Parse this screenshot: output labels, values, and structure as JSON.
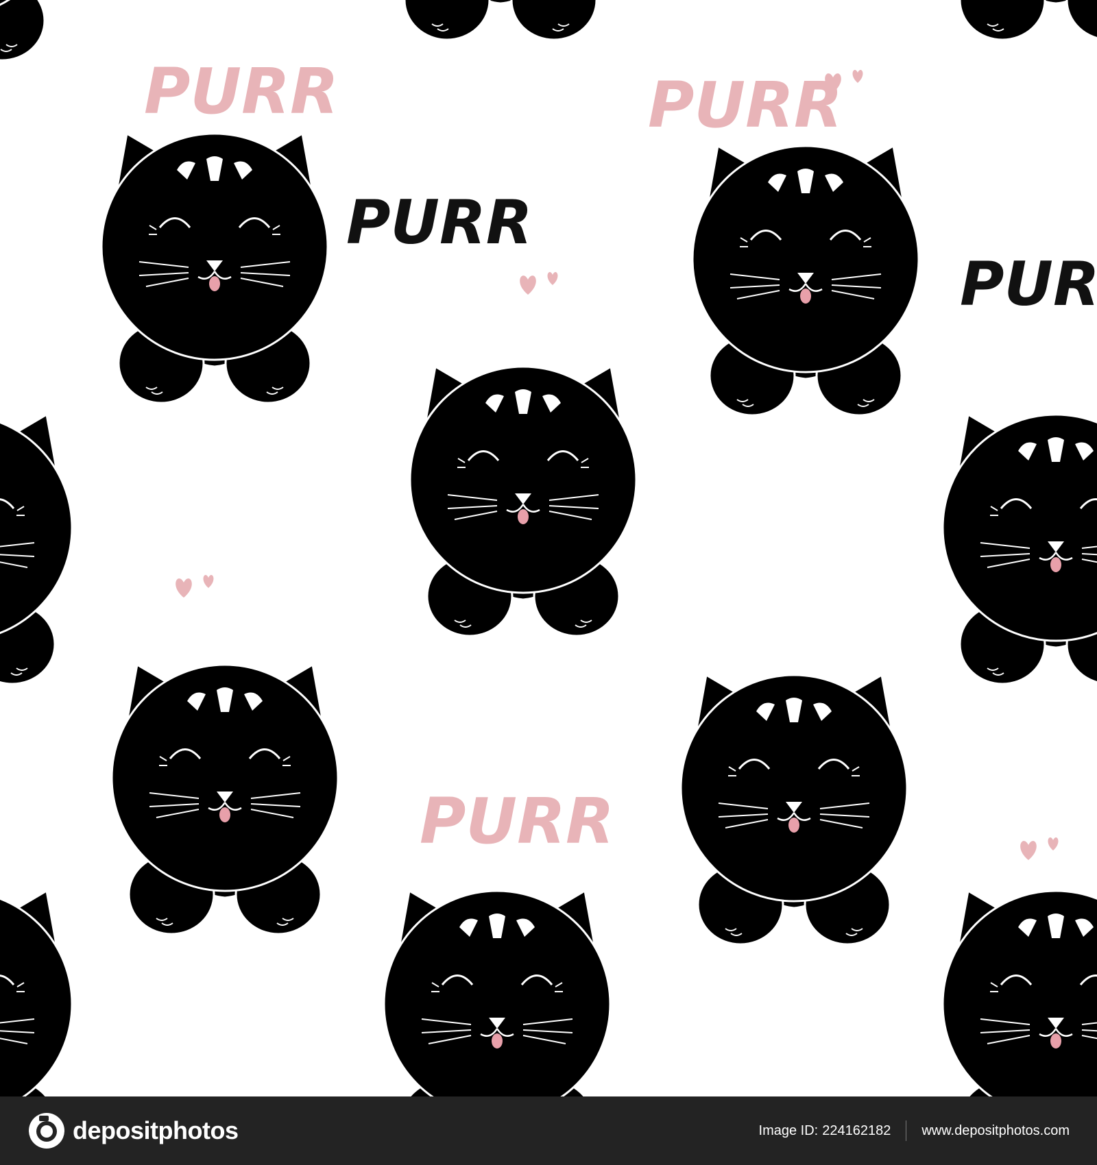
{
  "pattern": {
    "words": [
      "PURR",
      "PURR",
      "PURR",
      "PURR",
      "PURR"
    ],
    "background_color": "#ffffff",
    "cat_color": "#000000",
    "accent_color": "#e8b4b8",
    "word_colors": [
      "#e8b4b8",
      "#e8b4b8",
      "#111111",
      "#111111",
      "#e8b4b8"
    ],
    "watermark_text": "depositphotos"
  },
  "footer": {
    "background_color": "#232323",
    "logo_text": "depositphotos",
    "image_id_label": "Image ID:",
    "image_id": "224162182",
    "website": "www.depositphotos.com"
  }
}
